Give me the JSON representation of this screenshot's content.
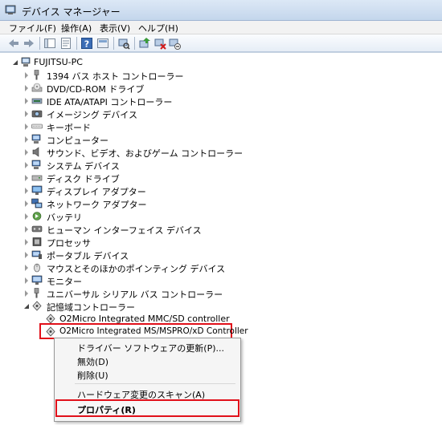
{
  "window": {
    "title": "デバイス マネージャー"
  },
  "menu": [
    "ファイル(F)",
    "操作(A)",
    "表示(V)",
    "ヘルプ(H)"
  ],
  "toolbar": {
    "buttons": [
      "back-icon",
      "forward-icon",
      "show-hide-console-tree-icon",
      "properties-icon",
      "help-icon",
      "console-icon",
      "scan-hardware-icon",
      "update-driver-icon",
      "disable-icon",
      "uninstall-icon"
    ]
  },
  "tree": {
    "root": "FUJITSU-PC",
    "categories": [
      "1394 バス ホスト コントローラー",
      "DVD/CD-ROM ドライブ",
      "IDE ATA/ATAPI コントローラー",
      "イメージング デバイス",
      "キーボード",
      "コンピューター",
      "サウンド、ビデオ、およびゲーム コントローラー",
      "システム デバイス",
      "ディスク ドライブ",
      "ディスプレイ アダプター",
      "ネットワーク アダプター",
      "バッテリ",
      "ヒューマン インターフェイス デバイス",
      "プロセッサ",
      "ポータブル デバイス",
      "マウスとそのほかのポインティング デバイス",
      "モニター",
      "ユニバーサル シリアル バス コントローラー",
      "記憶域コントローラー"
    ],
    "children": [
      "O2Micro Integrated MMC/SD controller",
      "O2Micro Integrated MS/MSPRO/xD Controller"
    ]
  },
  "context_menu": {
    "update_driver": "ドライバー ソフトウェアの更新(P)...",
    "disable": "無効(D)",
    "uninstall": "削除(U)",
    "scan": "ハードウェア変更のスキャン(A)",
    "properties": "プロパティ(R)"
  },
  "colors": {
    "highlight_border": "#e1101a"
  }
}
